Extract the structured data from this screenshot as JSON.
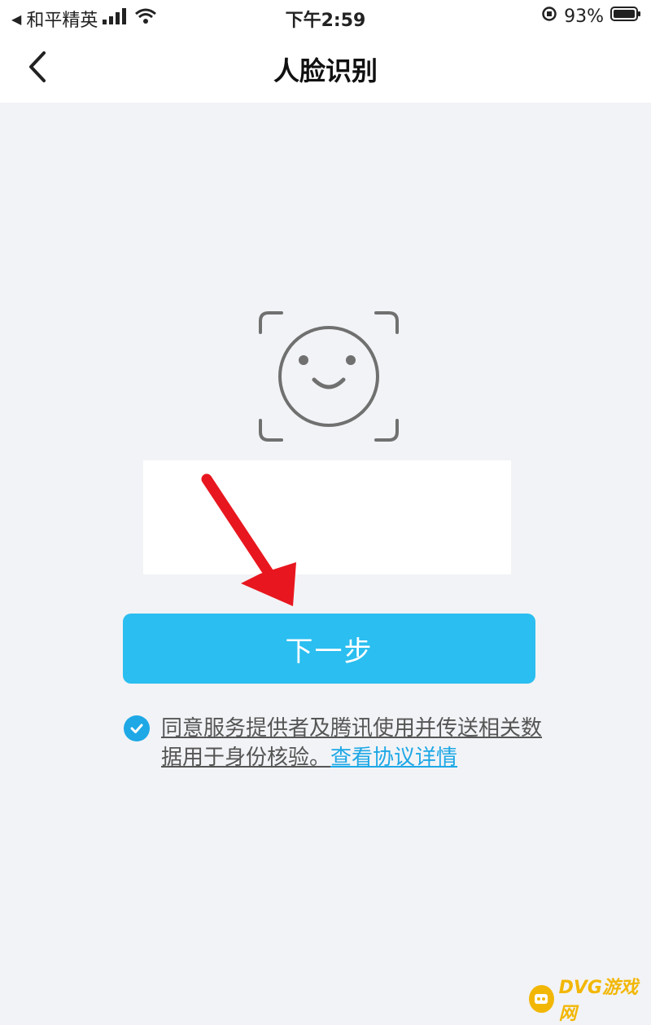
{
  "status_bar": {
    "carrier": "和平精英",
    "time": "下午2:59",
    "battery": "93%"
  },
  "nav": {
    "title": "人脸识别",
    "back_icon": "chevron-left-icon"
  },
  "face_icon": "face-scan-icon",
  "primary_button": {
    "label": "下一步"
  },
  "agreement": {
    "checked": true,
    "text": "同意服务提供者及腾讯使用并传送相关数据用于身份核验。",
    "link_text": "查看协议详情"
  },
  "watermark": {
    "text": "DVG游戏网"
  },
  "colors": {
    "accent": "#2bbef0",
    "link": "#1ea8e6",
    "background": "#f2f3f6",
    "arrow": "#e8171f"
  }
}
